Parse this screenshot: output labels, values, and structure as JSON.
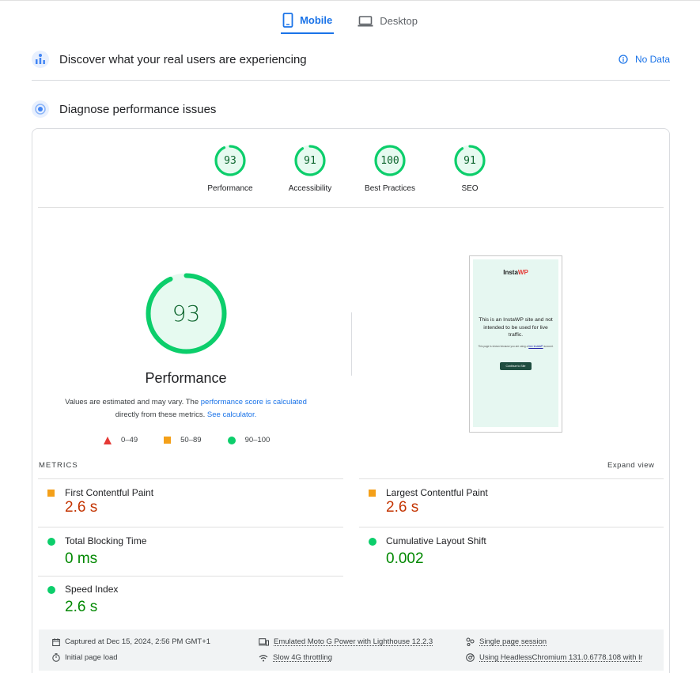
{
  "tabs": [
    {
      "label": "Mobile",
      "active": true,
      "icon": "smartphone-icon"
    },
    {
      "label": "Desktop",
      "active": false,
      "icon": "laptop-icon"
    }
  ],
  "crux": {
    "title": "Discover what your real users are experiencing",
    "status": "No Data"
  },
  "diagnose": {
    "title": "Diagnose performance issues"
  },
  "categories": [
    {
      "label": "Performance",
      "score": "93"
    },
    {
      "label": "Accessibility",
      "score": "91"
    },
    {
      "label": "Best Practices",
      "score": "100"
    },
    {
      "label": "SEO",
      "score": "91"
    }
  ],
  "main_gauge": {
    "score": "93",
    "title": "Performance",
    "desc_prefix": "Values are estimated and may vary. The ",
    "desc_link1": "performance score is calculated",
    "desc_mid": " directly from these metrics. ",
    "desc_link2": "See calculator."
  },
  "legend": {
    "fail": "0–49",
    "average": "50–89",
    "pass": "90–100"
  },
  "screenshot": {
    "logo_text": "Insta",
    "logo_accent": "WP",
    "message": "This is an InstaWP site and not intended to be used for live traffic.",
    "small_text": "This page is shown because you are using a",
    "small_link": "free InstaWP",
    "small_suffix": "account.",
    "button": "Continue to Site"
  },
  "metrics": {
    "heading": "METRICS",
    "expand": "Expand view",
    "items": [
      {
        "label": "First Contentful Paint",
        "value": "2.6 s",
        "status": "average"
      },
      {
        "label": "Largest Contentful Paint",
        "value": "2.6 s",
        "status": "average"
      },
      {
        "label": "Total Blocking Time",
        "value": "0 ms",
        "status": "pass"
      },
      {
        "label": "Cumulative Layout Shift",
        "value": "0.002",
        "status": "pass"
      },
      {
        "label": "Speed Index",
        "value": "2.6 s",
        "status": "pass"
      }
    ]
  },
  "footer": {
    "captured": "Captured at Dec 15, 2024, 2:56 PM GMT+1",
    "initial": "Initial page load",
    "device": "Emulated Moto G Power with Lighthouse 12.2.3",
    "throttle": "Slow 4G throttling",
    "session": "Single page session",
    "browser": "Using HeadlessChromium 131.0.6778.108 with lr"
  },
  "colors": {
    "pass": "#0cce6b",
    "average": "#ffa400",
    "fail": "#ff4e42",
    "accent": "#1a73e8"
  }
}
